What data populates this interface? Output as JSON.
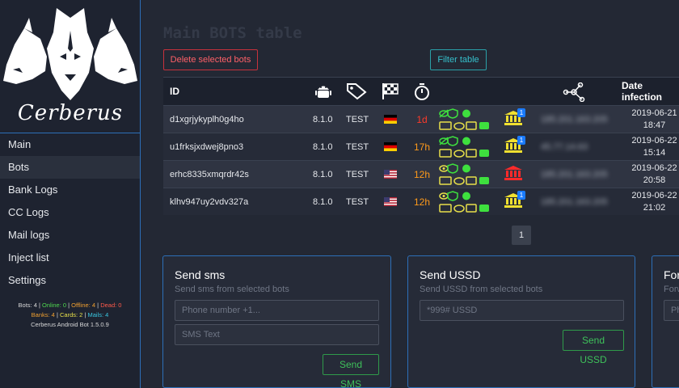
{
  "brand": {
    "name": "Cerberus"
  },
  "sidebar": {
    "items": [
      {
        "label": "Main"
      },
      {
        "label": "Bots"
      },
      {
        "label": "Bank Logs"
      },
      {
        "label": "CC Logs"
      },
      {
        "label": "Mail logs"
      },
      {
        "label": "Inject list"
      },
      {
        "label": "Settings"
      }
    ],
    "active": "Bots",
    "stats": {
      "bots": "Bots: 4",
      "online": "Online: 0",
      "offline": "Offline: 4",
      "dead": "Dead: 0",
      "banks": "Banks: 4",
      "cards": "Cards: 2",
      "mails": "Mails: 4",
      "version": "Cerberus Android Bot 1.5.0.9"
    }
  },
  "main": {
    "title": "Main BOTS table",
    "delete_button": "Delete selected bots",
    "filter_button": "Filter table",
    "table": {
      "headers": {
        "id": "ID",
        "date": "Date infection"
      },
      "header_icons": [
        "android-icon",
        "tag-icon",
        "checkered-flag-icon",
        "stopwatch-icon",
        "network-icon"
      ],
      "rows": [
        {
          "id": "d1xgrjykyplh0g4ho",
          "version": "8.1.0",
          "tag": "TEST",
          "country": "DE",
          "last_seen": "1d",
          "last_seen_color": "#ff3a2a",
          "bank_state": "yellow",
          "bank_count": "1",
          "ip": "185.201.163.205",
          "date": "2019-06-21",
          "time": "18:47"
        },
        {
          "id": "u1frksjxdwej8pno3",
          "version": "8.1.0",
          "tag": "TEST",
          "country": "DE",
          "last_seen": "17h",
          "last_seen_color": "#ff9a1a",
          "bank_state": "yellow",
          "bank_count": "1",
          "ip": "45.77.14.63",
          "date": "2019-06-22",
          "time": "15:14"
        },
        {
          "id": "erhc8335xmqrdr42s",
          "version": "8.1.0",
          "tag": "TEST",
          "country": "US",
          "last_seen": "12h",
          "last_seen_color": "#ff9a1a",
          "bank_state": "red",
          "bank_count": "",
          "ip": "185.201.163.205",
          "date": "2019-06-22",
          "time": "20:58"
        },
        {
          "id": "klhv947uy2vdv327a",
          "version": "8.1.0",
          "tag": "TEST",
          "country": "US",
          "last_seen": "12h",
          "last_seen_color": "#ff9a1a",
          "bank_state": "yellow",
          "bank_count": "1",
          "ip": "185.201.163.205",
          "date": "2019-06-22",
          "time": "21:02"
        }
      ]
    },
    "pagination": {
      "current": "1"
    },
    "cards": {
      "sms": {
        "title": "Send sms",
        "subtitle": "Send sms from selected bots",
        "phone_placeholder": "Phone number +1...",
        "text_placeholder": "SMS Text",
        "button": "Send SMS"
      },
      "ussd": {
        "title": "Send USSD",
        "subtitle": "Send USSD from selected bots",
        "placeholder": "*999# USSD",
        "button": "Send USSD"
      },
      "third": {
        "title": "For",
        "subtitle": "Forw",
        "placeholder": "Ph"
      }
    }
  },
  "colors": {
    "accent_blue": "#2d6fb8",
    "danger": "#c8323c",
    "success": "#3ec15a",
    "bg": "#232834",
    "sidebar": "#1e2330"
  }
}
